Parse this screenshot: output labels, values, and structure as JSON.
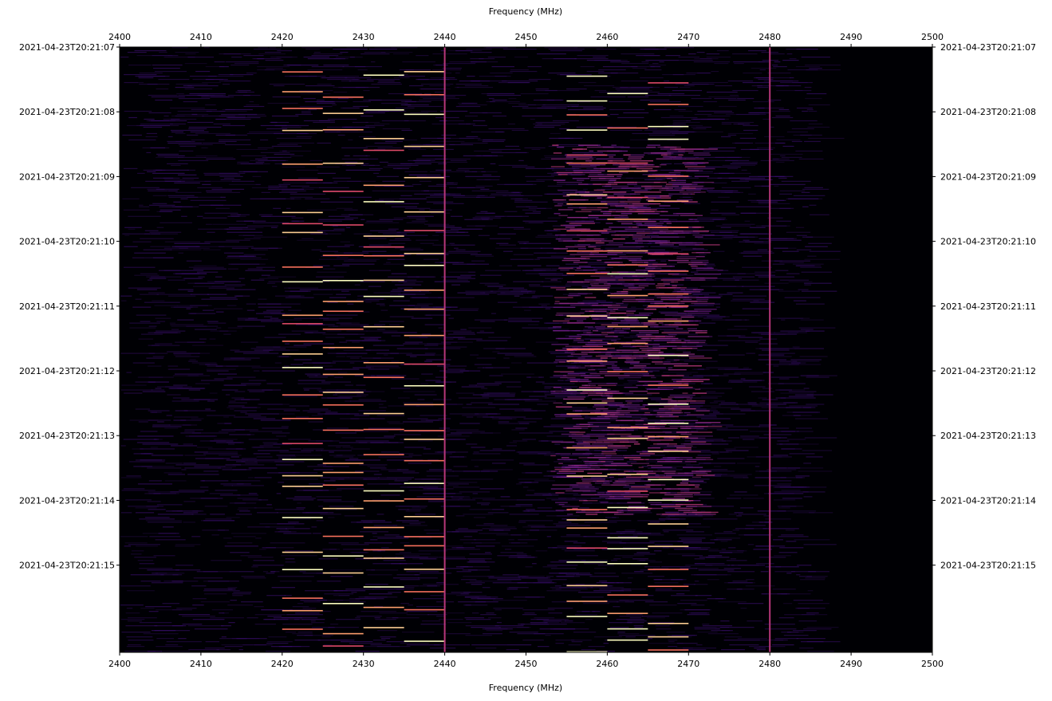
{
  "chart_data": {
    "type": "heatmap",
    "title": "",
    "xlabel": "Frequency (MHz)",
    "xlim": [
      2400,
      2500
    ],
    "x_ticks": [
      2400,
      2410,
      2420,
      2430,
      2440,
      2450,
      2460,
      2470,
      2480,
      2490,
      2500
    ],
    "ylabel": "",
    "y_ticks": [
      "2021-04-23T20:21:07",
      "2021-04-23T20:21:08",
      "2021-04-23T20:21:09",
      "2021-04-23T20:21:10",
      "2021-04-23T20:21:11",
      "2021-04-23T20:21:12",
      "2021-04-23T20:21:13",
      "2021-04-23T20:21:14",
      "2021-04-23T20:21:15"
    ],
    "y_range_seconds": [
      0,
      9.3
    ],
    "colormap": "magma",
    "colors": {
      "low": "#000004",
      "mid": "#721f81",
      "high": "#fcfdbf"
    },
    "persistent_carriers_mhz": [
      2440,
      2480
    ],
    "bursty_channels_mhz": [
      [
        2420,
        2425
      ],
      [
        2425,
        2430
      ],
      [
        2430,
        2435
      ],
      [
        2435,
        2440
      ],
      [
        2455,
        2460
      ],
      [
        2460,
        2465
      ],
      [
        2465,
        2470
      ]
    ],
    "wideband_region_mhz": [
      2453,
      2471
    ],
    "wideband_region_seconds": [
      1.5,
      7.2
    ],
    "grid": false,
    "legend": "none"
  }
}
